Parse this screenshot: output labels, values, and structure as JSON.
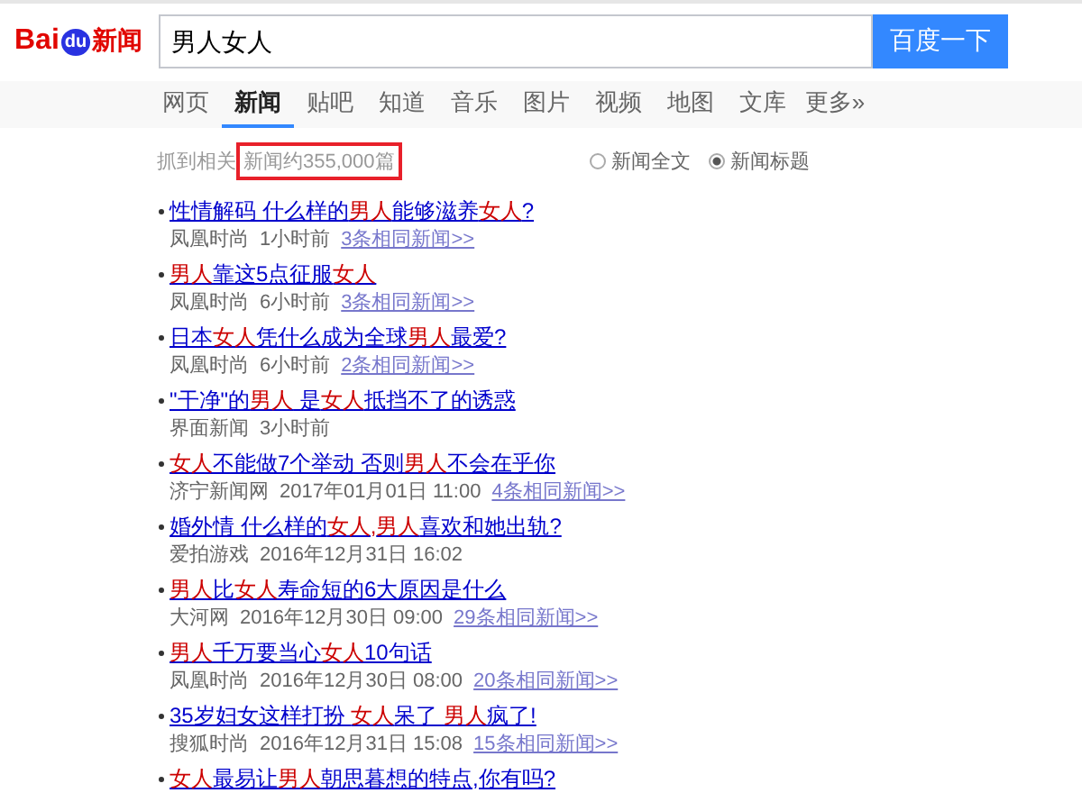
{
  "logo": {
    "brand_a": "Bai",
    "brand_b": "du",
    "brand_c": "新闻"
  },
  "search": {
    "value": "男人女人",
    "button": "百度一下"
  },
  "tabs": [
    {
      "label": "网页",
      "selected": false
    },
    {
      "label": "新闻",
      "selected": true
    },
    {
      "label": "贴吧",
      "selected": false
    },
    {
      "label": "知道",
      "selected": false
    },
    {
      "label": "音乐",
      "selected": false
    },
    {
      "label": "图片",
      "selected": false
    },
    {
      "label": "视频",
      "selected": false
    },
    {
      "label": "地图",
      "selected": false
    },
    {
      "label": "文库",
      "selected": false
    },
    {
      "label": "更多»",
      "selected": false
    }
  ],
  "result_count": {
    "prefix": "抓到相关",
    "value": "新闻约355,000篇",
    "boxed": true
  },
  "scope_options": [
    {
      "label": "新闻全文",
      "selected": false
    },
    {
      "label": "新闻标题",
      "selected": true
    }
  ],
  "results": [
    {
      "title": [
        {
          "text": "性情解码 什么样的",
          "hit": false
        },
        {
          "text": "男人",
          "hit": true
        },
        {
          "text": "能够滋养",
          "hit": false
        },
        {
          "text": "女人",
          "hit": true
        },
        {
          "text": "?",
          "hit": false
        }
      ],
      "source": "凤凰时尚",
      "time": "1小时前",
      "related": "3条相同新闻>>"
    },
    {
      "title": [
        {
          "text": "男人",
          "hit": true
        },
        {
          "text": "靠这5点征服",
          "hit": false
        },
        {
          "text": "女人",
          "hit": true
        }
      ],
      "source": "凤凰时尚",
      "time": "6小时前",
      "related": "3条相同新闻>>"
    },
    {
      "title": [
        {
          "text": "日本",
          "hit": false
        },
        {
          "text": "女人",
          "hit": true
        },
        {
          "text": "凭什么成为全球",
          "hit": false
        },
        {
          "text": "男人",
          "hit": true
        },
        {
          "text": "最爱?",
          "hit": false
        }
      ],
      "source": "凤凰时尚",
      "time": "6小时前",
      "related": "2条相同新闻>>"
    },
    {
      "title": [
        {
          "text": "\"干净\"的",
          "hit": false
        },
        {
          "text": "男人",
          "hit": true
        },
        {
          "text": " 是",
          "hit": false
        },
        {
          "text": "女人",
          "hit": true
        },
        {
          "text": "抵挡不了的诱惑",
          "hit": false
        }
      ],
      "source": "界面新闻",
      "time": "3小时前"
    },
    {
      "title": [
        {
          "text": "女人",
          "hit": true
        },
        {
          "text": "不能做7个举动 否则",
          "hit": false
        },
        {
          "text": "男人",
          "hit": true
        },
        {
          "text": "不会在乎你",
          "hit": false
        }
      ],
      "source": "济宁新闻网",
      "time": "2017年01月01日 11:00",
      "related": "4条相同新闻>>"
    },
    {
      "title": [
        {
          "text": "婚外情 什么样的",
          "hit": false
        },
        {
          "text": "女人,",
          "hit": true
        },
        {
          "text": "男人",
          "hit": true
        },
        {
          "text": "喜欢和她出轨?",
          "hit": false
        }
      ],
      "source": "爱拍游戏",
      "time": "2016年12月31日 16:02"
    },
    {
      "title": [
        {
          "text": "男人",
          "hit": true
        },
        {
          "text": "比",
          "hit": false
        },
        {
          "text": "女人",
          "hit": true
        },
        {
          "text": "寿命短的6大原因是什么",
          "hit": false
        }
      ],
      "source": "大河网",
      "time": "2016年12月30日 09:00",
      "related": "29条相同新闻>>"
    },
    {
      "title": [
        {
          "text": "男人",
          "hit": true
        },
        {
          "text": "千万要当心",
          "hit": false
        },
        {
          "text": "女人",
          "hit": true
        },
        {
          "text": "10句话",
          "hit": false
        }
      ],
      "source": "凤凰时尚",
      "time": "2016年12月30日 08:00",
      "related": "20条相同新闻>>"
    },
    {
      "title": [
        {
          "text": "35岁妇女这样打扮 ",
          "hit": false
        },
        {
          "text": "女人",
          "hit": true
        },
        {
          "text": "呆了 ",
          "hit": false
        },
        {
          "text": "男人",
          "hit": true
        },
        {
          "text": "疯了!",
          "hit": false
        }
      ],
      "source": "搜狐时尚",
      "time": "2016年12月31日 15:08",
      "related": "15条相同新闻>>"
    },
    {
      "title": [
        {
          "text": "女人",
          "hit": true
        },
        {
          "text": "最易让",
          "hit": false
        },
        {
          "text": "男人",
          "hit": true
        },
        {
          "text": "朝思暮想的特点,你有吗?",
          "hit": false
        }
      ]
    }
  ]
}
